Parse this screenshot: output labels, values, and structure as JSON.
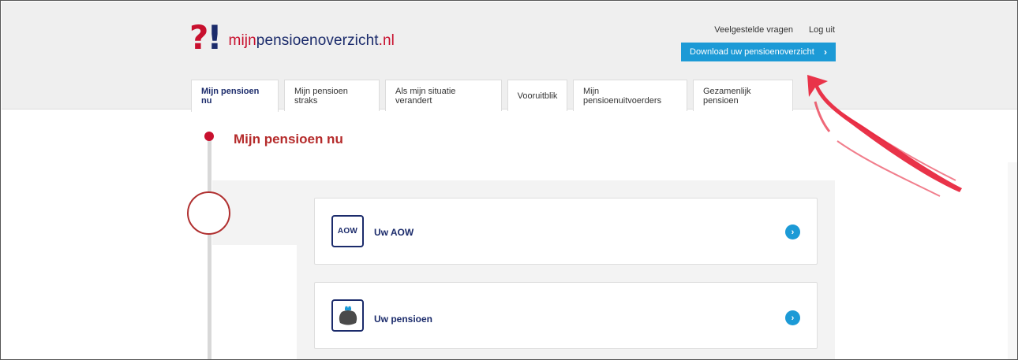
{
  "logo": {
    "mark_q": "?",
    "mark_ex": "!",
    "text_part1": "mijn",
    "text_part2": "pensioenoverzicht",
    "text_part3": ".nl"
  },
  "top_links": {
    "faq": "Veelgestelde vragen",
    "logout": "Log uit"
  },
  "download_button": {
    "label": "Download uw pensioenoverzicht",
    "chevron": "›"
  },
  "tabs": [
    {
      "label": "Mijn pensioen nu",
      "active": true
    },
    {
      "label": "Mijn pensioen straks",
      "active": false
    },
    {
      "label": "Als mijn situatie verandert",
      "active": false
    },
    {
      "label": "Vooruitblik",
      "active": false
    },
    {
      "label": "Mijn pensioenuitvoerders",
      "active": false
    },
    {
      "label": "Gezamenlijk pensioen",
      "active": false
    }
  ],
  "section": {
    "title": "Mijn pensioen nu"
  },
  "cards": [
    {
      "icon": "aow-icon",
      "icon_text": "AOW",
      "label": "Uw AOW",
      "arrow": "›"
    },
    {
      "icon": "wallet-icon",
      "label": "Uw pensioen",
      "arrow": "›"
    }
  ],
  "colors": {
    "brand_red": "#c8102e",
    "brand_navy": "#1b2b6b",
    "accent_blue": "#1c9ad6",
    "header_bg": "#efefef",
    "annotation_arrow": "#e8283f"
  }
}
